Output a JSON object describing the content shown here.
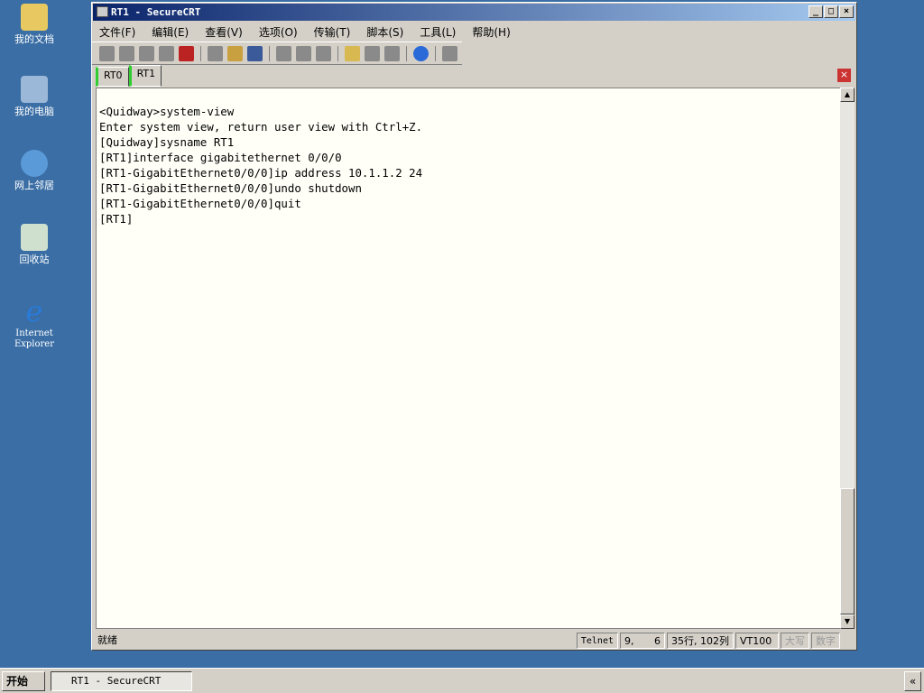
{
  "desktop": {
    "icons": [
      "我的文档",
      "我的电脑",
      "网上邻居",
      "回收站",
      "Internet Explorer"
    ]
  },
  "window": {
    "title": "RT1 - SecureCRT"
  },
  "menu": [
    "文件(F)",
    "编辑(E)",
    "查看(V)",
    "选项(O)",
    "传输(T)",
    "脚本(S)",
    "工具(L)",
    "帮助(H)"
  ],
  "tabs": [
    "RT0",
    "RT1"
  ],
  "terminal": {
    "lines": [
      "<Quidway>system-view",
      "Enter system view, return user view with Ctrl+Z.",
      "[Quidway]sysname RT1",
      "[RT1]interface gigabitethernet 0/0/0",
      "[RT1-GigabitEthernet0/0/0]ip address 10.1.1.2 24",
      "[RT1-GigabitEthernet0/0/0]undo shutdown",
      "[RT1-GigabitEthernet0/0/0]quit",
      "[RT1]"
    ]
  },
  "status": {
    "ready": "就绪",
    "protocol": "Telnet",
    "cursor_row": "9,",
    "cursor_col": "6",
    "size": "35行, 102列",
    "emulation": "VT100",
    "caps": "大写",
    "num": "数字"
  },
  "taskbar": {
    "start": "开始",
    "task": "RT1 - SecureCRT",
    "expand": "«"
  }
}
